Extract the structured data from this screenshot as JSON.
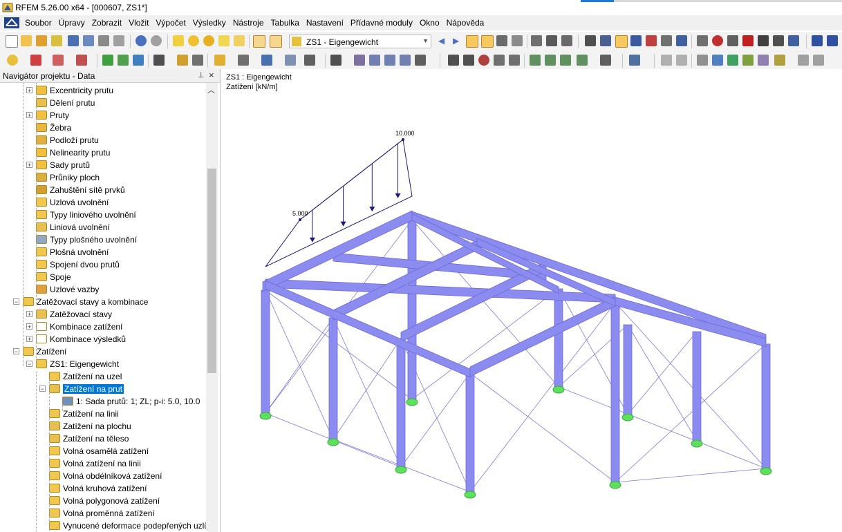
{
  "window": {
    "title": "RFEM 5.26.00 x64 - [000607, ZS1*]"
  },
  "menu": [
    "Soubor",
    "Úpravy",
    "Zobrazit",
    "Vložit",
    "Výpočet",
    "Výsledky",
    "Nástroje",
    "Tabulka",
    "Nastavení",
    "Přídavné moduly",
    "Okno",
    "Nápověda"
  ],
  "toolbar": {
    "loadcase_select": "ZS1 - Eigengewicht"
  },
  "navigator": {
    "title": "Navigátor projektu - Data",
    "items": [
      {
        "label": "Excentricity prutu",
        "expand": "+"
      },
      {
        "label": "Dělení prutu"
      },
      {
        "label": "Pruty",
        "expand": "+"
      },
      {
        "label": "Žebra"
      },
      {
        "label": "Podloží prutu"
      },
      {
        "label": "Nelinearity prutu"
      },
      {
        "label": "Sady prutů",
        "expand": "+"
      },
      {
        "label": "Průniky ploch"
      },
      {
        "label": "Zahuštění sítě prvků"
      },
      {
        "label": "Uzlová uvolnění"
      },
      {
        "label": "Typy liniového uvolnění"
      },
      {
        "label": "Liniová uvolnění"
      },
      {
        "label": "Typy plošného uvolnění"
      },
      {
        "label": "Plošná uvolnění"
      },
      {
        "label": "Spojení dvou prutů"
      },
      {
        "label": "Spoje"
      },
      {
        "label": "Uzlové vazby"
      },
      {
        "label": "Zatěžovací stavy a kombinace",
        "expand": "-"
      },
      {
        "label": "Zatěžovací stavy",
        "expand": "+"
      },
      {
        "label": "Kombinace zatížení",
        "expand": "+"
      },
      {
        "label": "Kombinace výsledků",
        "expand": "+"
      },
      {
        "label": "Zatížení",
        "expand": "-"
      },
      {
        "label": "ZS1: Eigengewicht",
        "expand": "-"
      },
      {
        "label": "Zatížení na uzel"
      },
      {
        "label": "Zatížení na prut",
        "expand": "-",
        "selected": true
      },
      {
        "label": "1: Sada prutů: 1; ZL; p-i: 5.0, 10.0"
      },
      {
        "label": "Zatížení na linii"
      },
      {
        "label": "Zatížení na plochu"
      },
      {
        "label": "Zatížení na těleso"
      },
      {
        "label": "Volná osamělá zatížení"
      },
      {
        "label": "Volná zatížení na linii"
      },
      {
        "label": "Volná obdélníková zatížení"
      },
      {
        "label": "Volná kruhová zatížení"
      },
      {
        "label": "Volná polygonová zatížení"
      },
      {
        "label": "Volná proměnná zatížení"
      },
      {
        "label": "Vynucené deformace podepřených uzlů"
      }
    ]
  },
  "view": {
    "line1": "ZS1 : Eigengewicht",
    "line2": "Zatížení [kN/m]",
    "load_start_label": "5.000",
    "load_end_label": "10.000",
    "load_start_value": 5.0,
    "load_end_value": 10.0
  },
  "colors": {
    "member": "#8c8cf0",
    "member_edge": "#6a6ad8",
    "support": "#5ee05e",
    "load": "#1a1a7a",
    "selection": "#0078d7"
  }
}
